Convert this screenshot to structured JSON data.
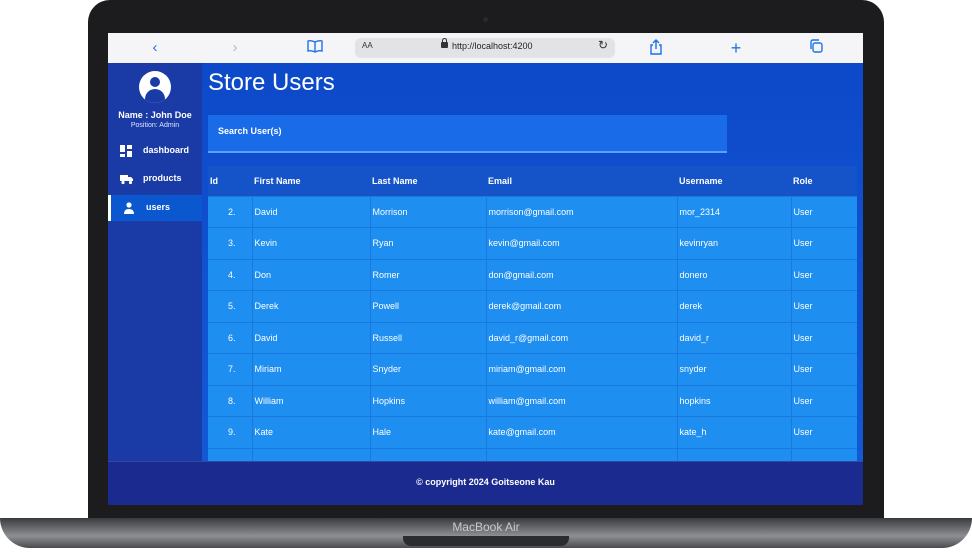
{
  "device": {
    "label": "MacBook Air"
  },
  "browser": {
    "back_icon": "‹",
    "forward_icon": "›",
    "reader_icon": "book-icon",
    "text_size": "AA",
    "url": "http://localhost:4200",
    "reload_icon": "↻",
    "share_icon": "share-icon",
    "new_tab_icon": "+",
    "tabs_icon": "tabs-icon"
  },
  "sidebar": {
    "user_name": "Name : John Doe",
    "user_position": "Position: Admin",
    "items": [
      {
        "label": "dashboard",
        "icon": "dashboard-icon",
        "active": false
      },
      {
        "label": "products",
        "icon": "truck-icon",
        "active": false
      },
      {
        "label": "users",
        "icon": "user-icon",
        "active": true
      }
    ]
  },
  "main": {
    "title": "Store Users",
    "search_label": "Search User(s)"
  },
  "table": {
    "headers": [
      "Id",
      "First Name",
      "Last Name",
      "Email",
      "Username",
      "Role"
    ],
    "rows": [
      [
        "2.",
        "David",
        "Morrison",
        "morrison@gmail.com",
        "mor_2314",
        "User"
      ],
      [
        "3.",
        "Kevin",
        "Ryan",
        "kevin@gmail.com",
        "kevinryan",
        "User"
      ],
      [
        "4.",
        "Don",
        "Romer",
        "don@gmail.com",
        "donero",
        "User"
      ],
      [
        "5.",
        "Derek",
        "Powell",
        "derek@gmail.com",
        "derek",
        "User"
      ],
      [
        "6.",
        "David",
        "Russell",
        "david_r@gmail.com",
        "david_r",
        "User"
      ],
      [
        "7.",
        "Miriam",
        "Snyder",
        "miriam@gmail.com",
        "snyder",
        "User"
      ],
      [
        "8.",
        "William",
        "Hopkins",
        "william@gmail.com",
        "hopkins",
        "User"
      ],
      [
        "9.",
        "Kate",
        "Hale",
        "kate@gmail.com",
        "kate_h",
        "User"
      ],
      [
        "",
        "",
        "",
        "",
        "",
        ""
      ]
    ]
  },
  "footer": {
    "text": "© copyright 2024 Goitseone Kau"
  },
  "colors": {
    "accent": "#0b57d0",
    "sidebar": "#1a3ba6",
    "row": "#1e8ef0",
    "footer": "#1a2a8f"
  }
}
